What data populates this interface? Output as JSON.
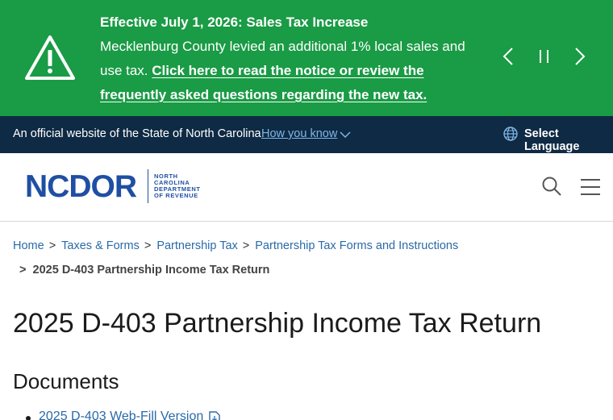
{
  "alert": {
    "title": "Effective July 1, 2026: Sales Tax Increase",
    "body": "Mecklenburg County levied an additional 1% local sales and use tax.",
    "link": "Click here to read the notice or review the frequently asked questions regarding the new tax.",
    "icon": "warning-icon"
  },
  "official_bar": {
    "text": "An official website of the State of North Carolina",
    "how_know": "How you know",
    "language": "Select Language"
  },
  "header": {
    "logo_word": "NCDOR",
    "logo_sub_1": "NORTH",
    "logo_sub_2": "CAROLINA",
    "logo_sub_3": "DEPARTMENT",
    "logo_sub_4": "OF REVENUE"
  },
  "breadcrumb": {
    "items": [
      "Home",
      "Taxes & Forms",
      "Partnership Tax",
      "Partnership Tax Forms and Instructions"
    ],
    "current": "2025 D-403 Partnership Income Tax Return",
    "separator": ">"
  },
  "page": {
    "title": "2025 D-403 Partnership Income Tax Return",
    "documents_heading": "Documents",
    "documents": [
      "2025 D-403 Web-Fill Version"
    ]
  },
  "colors": {
    "alert_bg": "#1a9b45",
    "official_bg": "#0f2a44",
    "brand": "#1f4fa3",
    "link": "#2a6aa8"
  }
}
